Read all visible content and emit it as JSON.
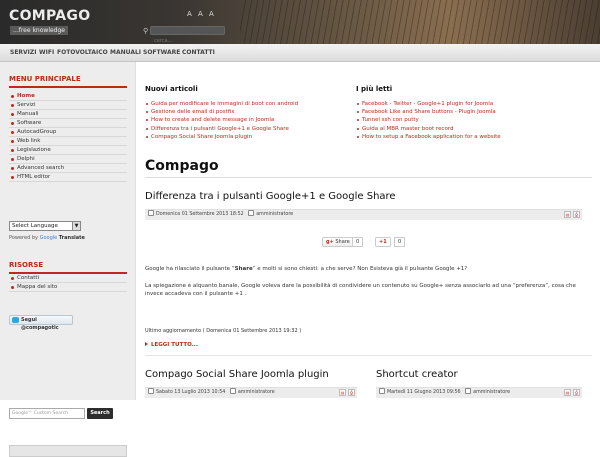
{
  "header": {
    "logo": "COMPAGO",
    "tagline": "...free knowledge",
    "font_sizer": "A A A",
    "search_placeholder": "cerca..."
  },
  "nav": [
    "SERVIZI",
    "WIFI",
    "FOTOVOLTAICO",
    "MANUALI",
    "SOFTWARE",
    "CONTATTI"
  ],
  "sidebar": {
    "menu_title": "MENU PRINCIPALE",
    "menu_items": [
      "Home",
      "Servizi",
      "Manuali",
      "Software",
      "AutocadGroup",
      "Web link",
      "Legislazione",
      "Delphi",
      "Advanced search",
      "HTML editor"
    ],
    "language_select": "Select Language",
    "powered_prefix": "Powered by",
    "powered_google": "Google",
    "powered_translate": "Translate",
    "resources_title": "RISORSE",
    "resource_items": [
      "Contatti",
      "Mappa del sito"
    ],
    "follow_label": "Segui @compagotic",
    "custom_search_placeholder": "Google™ Custom Search",
    "search_button": "Search"
  },
  "main": {
    "new_articles_title": "Nuovi articoli",
    "new_articles": [
      "Guida per modificare le immagini di boot con android",
      "Gestione delle email di postfix",
      "How to create and delete message in Joomla",
      "Differenza tra i pulsanti Google+1 e Google Share",
      "Compago Social Share Joomla plugin"
    ],
    "most_read_title": "I più letti",
    "most_read": [
      "Facebook - Twitter - Google+1 plugin for Joomla",
      "Facebook Like and Share buttons - Plugin Joomla",
      "Tunnel ssh con putty",
      "Guida al MBR master boot record",
      "How to setup a Facebook application for a website"
    ],
    "page_heading": "Compago",
    "article": {
      "title": "Differenza tra i pulsanti Google+1 e Google Share",
      "date": "Domenica 01 Settembre 2013 18:52",
      "author": "amministratore",
      "share_label": "Share",
      "share_count": "0",
      "plus_label": "+1",
      "plus_count": "0",
      "paragraph1_a": "Google ha rilasciato il pulsante “",
      "paragraph1_bold": "Share",
      "paragraph1_b": "” e molti si sono chiesti: a che serve? Non Esisteva già il pulsante Google +1?",
      "paragraph2_line1": "La spiegazione è alquanto banale, Google voleva dare la possibilità di condividere un contenuto su Google+ senza associarlo ad una “preferenza”, cosa che",
      "paragraph2_line2": "invece accadeva con il pulsante +1 .",
      "last_update": "Ultimo aggiornamento ( Domenica 01 Settembre 2013 19:32 )",
      "read_more": "LEGGI TUTTO..."
    },
    "article2": {
      "title": "Compago Social Share Joomla plugin",
      "date": "Sabato 13 Luglio 2013 10:54",
      "author": "amministratore"
    },
    "article3": {
      "title": "Shortcut creator",
      "date": "Martedì 11 Giugno 2013 09:56",
      "author": "amministratore"
    }
  }
}
